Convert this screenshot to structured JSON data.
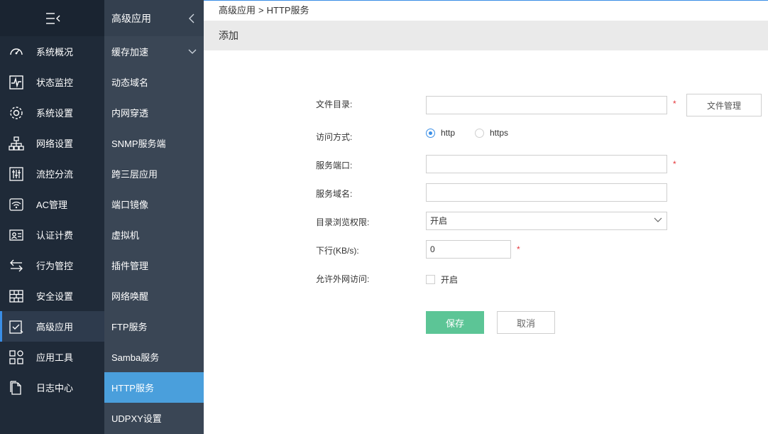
{
  "nav1": {
    "items": [
      {
        "label": "系统概况",
        "icon": "dashboard-icon"
      },
      {
        "label": "状态监控",
        "icon": "pulse-icon"
      },
      {
        "label": "系统设置",
        "icon": "gear-icon"
      },
      {
        "label": "网络设置",
        "icon": "network-icon"
      },
      {
        "label": "流控分流",
        "icon": "sliders-icon"
      },
      {
        "label": "AC管理",
        "icon": "wifi-icon"
      },
      {
        "label": "认证计费",
        "icon": "id-card-icon"
      },
      {
        "label": "行为管控",
        "icon": "arrows-icon"
      },
      {
        "label": "安全设置",
        "icon": "firewall-icon"
      },
      {
        "label": "高级应用",
        "icon": "checklist-icon"
      },
      {
        "label": "应用工具",
        "icon": "apps-icon"
      },
      {
        "label": "日志中心",
        "icon": "document-icon"
      }
    ],
    "active_index": 9
  },
  "nav2": {
    "title": "高级应用",
    "items": [
      {
        "label": "缓存加速"
      },
      {
        "label": "动态域名"
      },
      {
        "label": "内网穿透"
      },
      {
        "label": "SNMP服务端"
      },
      {
        "label": "跨三层应用"
      },
      {
        "label": "端口镜像"
      },
      {
        "label": "虚拟机"
      },
      {
        "label": "插件管理"
      },
      {
        "label": "网络唤醒"
      },
      {
        "label": "FTP服务"
      },
      {
        "label": "Samba服务"
      },
      {
        "label": "HTTP服务"
      },
      {
        "label": "UDPXY设置"
      }
    ],
    "active_index": 11
  },
  "breadcrumb": {
    "parent": "高级应用",
    "sep": ">",
    "current": "HTTP服务"
  },
  "sub_title": "添加",
  "form": {
    "dir_label": "文件目录:",
    "dir_value": "",
    "file_mgr_button": "文件管理",
    "access_label": "访问方式:",
    "access_options": [
      "http",
      "https"
    ],
    "access_selected": "http",
    "port_label": "服务端口:",
    "port_value": "",
    "domain_label": "服务域名:",
    "domain_value": "",
    "browse_label": "目录浏览权限:",
    "browse_value": "开启",
    "downlink_label": "下行(KB/s):",
    "downlink_value": "0",
    "wan_label": "允许外网访问:",
    "wan_option": "开启",
    "required_mark": "*",
    "save_button": "保存",
    "cancel_button": "取消"
  },
  "colors": {
    "accent": "#3a8ee6",
    "save": "#5cc596",
    "required": "#e5393d"
  }
}
